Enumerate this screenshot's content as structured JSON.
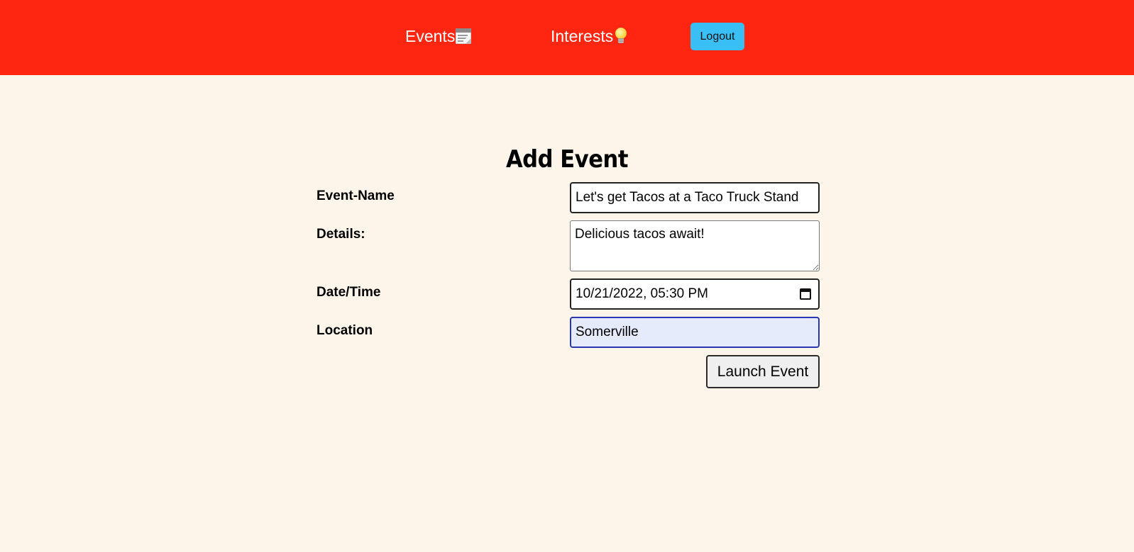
{
  "header": {
    "background_color": "#fe2611",
    "nav": {
      "events_label": "Events",
      "events_icon": "calendar-icon",
      "interests_label": "Interests",
      "interests_icon": "lightbulb-icon"
    },
    "logout_label": "Logout",
    "logout_color": "#3abff4"
  },
  "page": {
    "background_color": "#fdf5ea",
    "title": "Add Event"
  },
  "form": {
    "event_name": {
      "label": "Event-Name",
      "value": "Let's get Tacos at a Taco Truck Stand"
    },
    "details": {
      "label": "Details:",
      "value": "Delicious tacos await!"
    },
    "datetime": {
      "label": "Date/Time",
      "value": "10/21/2022, 05:30 PM",
      "icon": "calendar-picker-icon"
    },
    "location": {
      "label": "Location",
      "value": "Somerville",
      "focused": true,
      "focus_color": "#2b37b0",
      "autofill_color": "#e6ebfb"
    },
    "submit_label": "Launch Event"
  }
}
